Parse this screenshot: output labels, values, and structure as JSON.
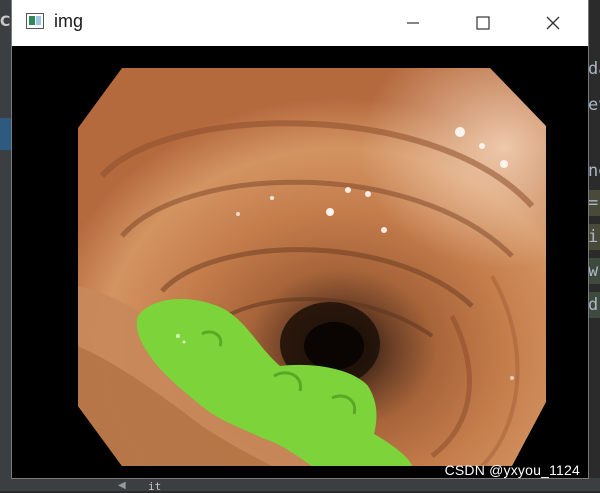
{
  "window": {
    "title": "img"
  },
  "controls": {
    "minimize": "minimize",
    "maximize": "maximize",
    "close": "close"
  },
  "image": {
    "subject": "endoscopic colon image with green segmentation overlay",
    "overlay_color": "#7dd33a",
    "background_color": "#000000"
  },
  "watermark": "CSDN @yxyou_1124",
  "background_ide": {
    "left_fragment": "CE",
    "right_fragments": [
      "da",
      "ev",
      "ne",
      "=",
      "i",
      "w",
      "d"
    ],
    "bottom_fragment": "it"
  }
}
